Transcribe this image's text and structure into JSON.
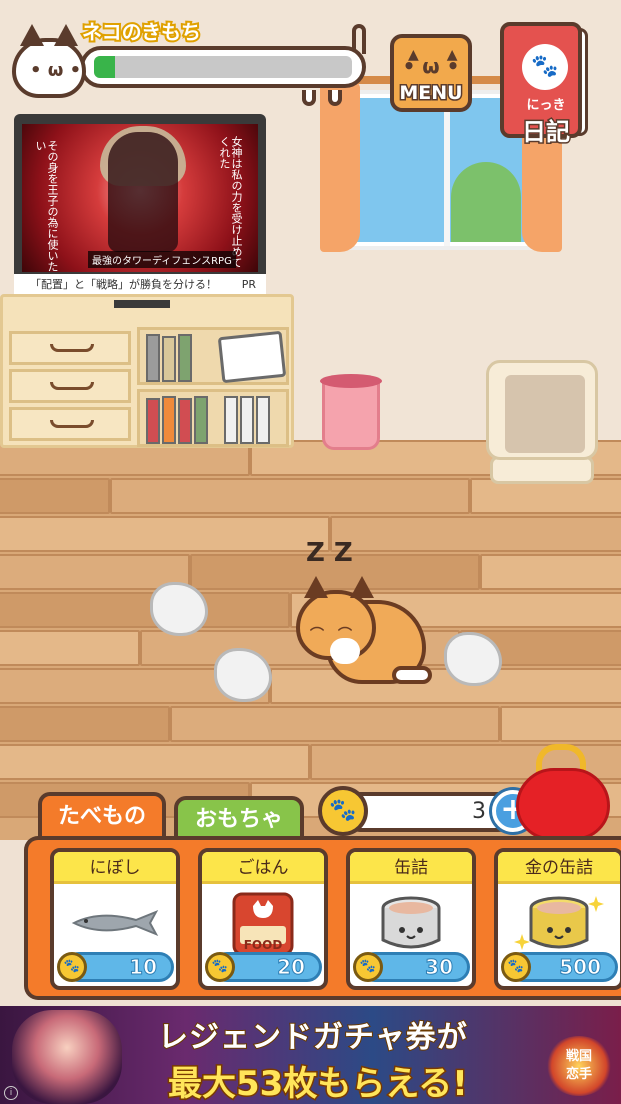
{
  "mood": {
    "title": "ネコのきもち",
    "level": 0.08
  },
  "buttons": {
    "menu_label": "MENU",
    "diary_ruby": "にっき",
    "diary_label": "日記"
  },
  "tv_ad": {
    "left_vertical": "その身を王子の為に使いたい",
    "right_vertical": "女神は私の力を受け止めてくれた",
    "caption": "最強のタワーディフェンスRPG",
    "strip_text": "「配置」と「戦略」が勝負を分ける！",
    "pr_label": "PR"
  },
  "sleep": "Z Z",
  "tabs": {
    "food": "たべもの",
    "toy": "おもちゃ"
  },
  "coins": {
    "count": "3",
    "add_label": "+"
  },
  "items": [
    {
      "name": "にぼし",
      "price": "10",
      "icon": "dried-sardine-icon"
    },
    {
      "name": "ごはん",
      "price": "20",
      "icon": "food-bag-icon",
      "bag_text": "FOOD"
    },
    {
      "name": "缶詰",
      "price": "30",
      "icon": "cat-can-icon"
    },
    {
      "name": "金の缶詰",
      "price": "500",
      "icon": "gold-can-icon"
    }
  ],
  "banner": {
    "line1": "レジェンドガチャ券が",
    "line2": "最大53枚もらえる!",
    "logo_text": "戦国\n恋手",
    "info": "i"
  },
  "colors": {
    "accent_orange": "#f47b2a",
    "toy_green": "#88c44a",
    "item_yellow": "#fce54a",
    "price_blue": "#5fb7e8",
    "mood_green": "#39b44a",
    "outline_brown": "#5a3b2c"
  }
}
